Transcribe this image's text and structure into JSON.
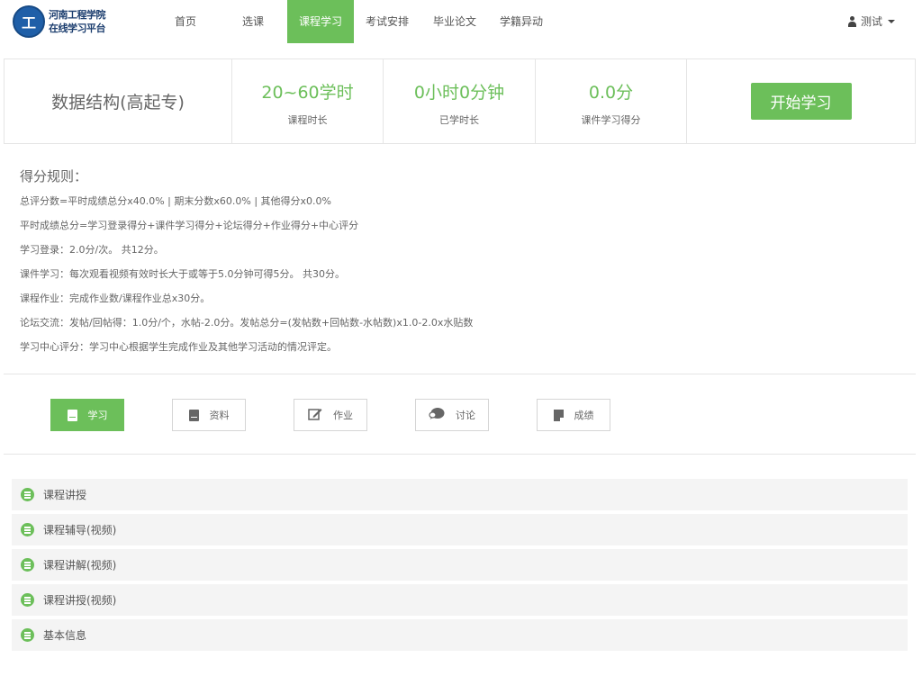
{
  "header": {
    "logo_glyph": "工",
    "logo_line1": "河南工程学院",
    "logo_line2": "在线学习平台",
    "nav": [
      {
        "label": "首页"
      },
      {
        "label": "选课"
      },
      {
        "label": "课程学习"
      },
      {
        "label": "考试安排"
      },
      {
        "label": "毕业论文"
      },
      {
        "label": "学籍异动"
      }
    ],
    "active_nav": "课程学习",
    "user_name": "测试"
  },
  "course": {
    "name": "数据结构(高起专)",
    "stats": [
      {
        "value": "20~60学时",
        "label": "课程时长"
      },
      {
        "value": "0小时0分钟",
        "label": "已学时长"
      },
      {
        "value": "0.0分",
        "label": "课件学习得分"
      }
    ],
    "start_label": "开始学习"
  },
  "rules": {
    "title": "得分规则：",
    "lines": [
      "总评分数=平时成绩总分x40.0% | 期末分数x60.0% | 其他得分x0.0%",
      "平时成绩总分=学习登录得分+课件学习得分+论坛得分+作业得分+中心评分",
      "学习登录：2.0分/次。 共12分。",
      "课件学习：每次观看视频有效时长大于或等于5.0分钟可得5分。 共30分。",
      "课程作业：完成作业数/课程作业总x30分。",
      "论坛交流：发帖/回帖得：1.0分/个，水帖-2.0分。发帖总分=(发帖数+回帖数-水帖数)x1.0-2.0x水贴数",
      "学习中心评分：学习中心根据学生完成作业及其他学习活动的情况评定。"
    ]
  },
  "tabs": [
    {
      "label": "学习",
      "icon": "book-icon"
    },
    {
      "label": "资料",
      "icon": "book-icon"
    },
    {
      "label": "作业",
      "icon": "edit-icon"
    },
    {
      "label": "讨论",
      "icon": "comment-icon"
    },
    {
      "label": "成绩",
      "icon": "file-icon"
    }
  ],
  "sections": [
    {
      "label": "课程讲授"
    },
    {
      "label": "课程辅导(视频)"
    },
    {
      "label": "课程讲解(视频)"
    },
    {
      "label": "课程讲授(视频)"
    },
    {
      "label": "基本信息"
    }
  ],
  "colors": {
    "accent": "#6cbf5a",
    "brand": "#1f5fa8"
  }
}
